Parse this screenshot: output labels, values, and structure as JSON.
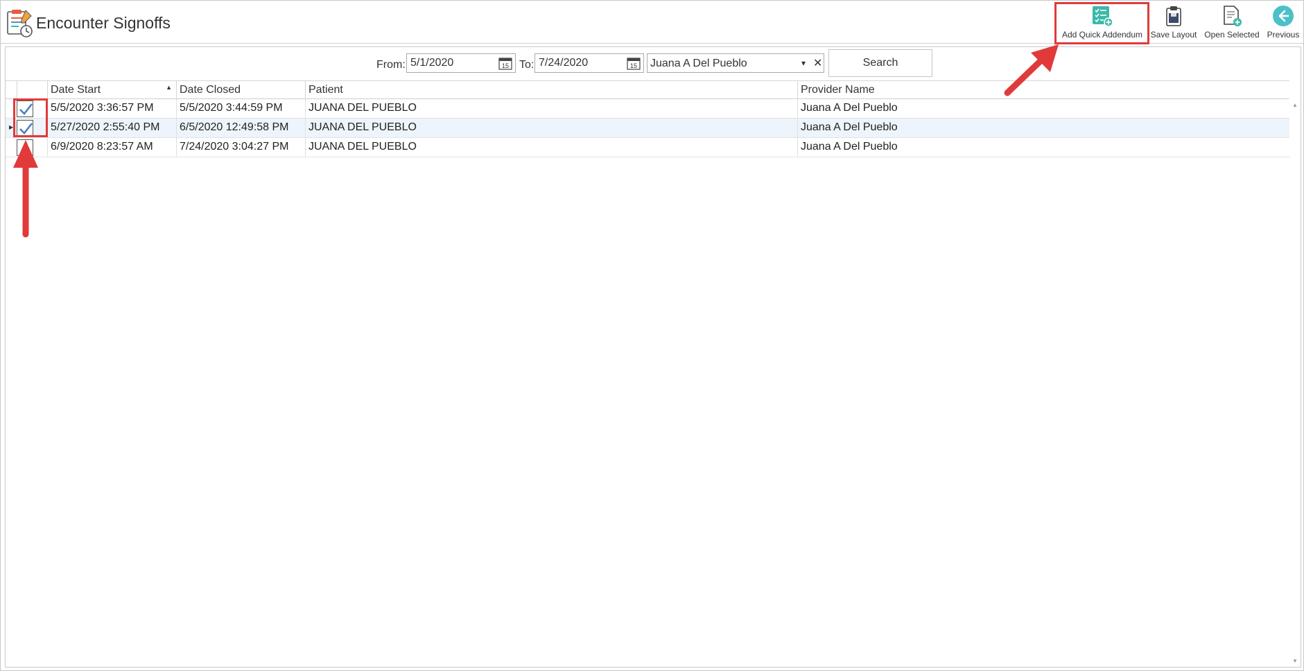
{
  "header": {
    "title": "Encounter Signoffs",
    "toolbar": {
      "add_quick_addendum": "Add Quick Addendum",
      "save_layout": "Save Layout",
      "open_selected": "Open Selected",
      "previous": "Previous"
    }
  },
  "filters": {
    "from_label": "From:",
    "from_value": "5/1/2020",
    "to_label": "To:",
    "to_value": "7/24/2020",
    "provider_value": "Juana A Del Pueblo",
    "search_label": "Search"
  },
  "grid": {
    "columns": [
      "Date Start",
      "Date Closed",
      "Patient",
      "Provider Name"
    ],
    "sorted_column": "Date Start",
    "rows": [
      {
        "checked": true,
        "date_start": "5/5/2020 3:36:57 PM",
        "date_closed": "5/5/2020 3:44:59 PM",
        "patient": "JUANA DEL PUEBLO",
        "provider": "Juana A Del Pueblo"
      },
      {
        "checked": true,
        "date_start": "5/27/2020 2:55:40 PM",
        "date_closed": "6/5/2020 12:49:58 PM",
        "patient": "JUANA DEL PUEBLO",
        "provider": "Juana A Del Pueblo",
        "focused": true
      },
      {
        "checked": false,
        "date_start": "6/9/2020 8:23:57 AM",
        "date_closed": "7/24/2020 3:04:27 PM",
        "patient": "JUANA DEL PUEBLO",
        "provider": "Juana A Del Pueblo"
      }
    ]
  },
  "colors": {
    "annotation_red": "#e03a3a",
    "teal_accent": "#3cb9a8",
    "check_blue": "#4a7fc1"
  },
  "icons": {
    "app": "clipboard-clock-icon",
    "add_quick_addendum": "checklist-plus-icon",
    "save_layout": "clipboard-save-icon",
    "open_selected": "document-plus-icon",
    "previous": "arrow-left-circle-icon"
  }
}
